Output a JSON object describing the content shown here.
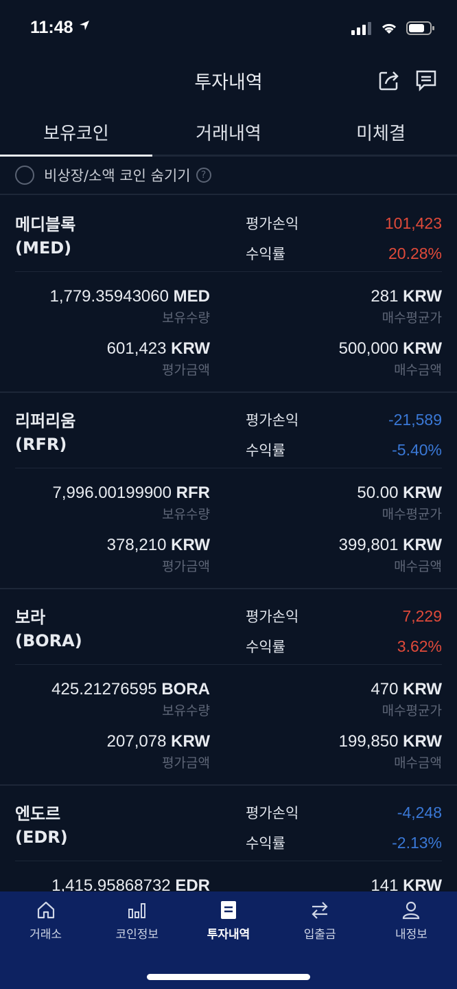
{
  "status": {
    "time": "11:48"
  },
  "header": {
    "title": "투자내역"
  },
  "tabs": [
    {
      "label": "보유코인",
      "active": true
    },
    {
      "label": "거래내역",
      "active": false
    },
    {
      "label": "미체결",
      "active": false
    }
  ],
  "filter": {
    "label": "비상장/소액 코인 숨기기",
    "help": "?"
  },
  "labels": {
    "pl": "평가손익",
    "rate": "수익률",
    "holding": "보유수량",
    "avg_price": "매수평균가",
    "eval_amount": "평가금액",
    "buy_amount": "매수금액"
  },
  "coins": [
    {
      "name": "메디블록",
      "symbol": "(MED)",
      "pl": "101,423",
      "rate": "20.28%",
      "trend": "up",
      "holding_num": "1,779.35943060",
      "holding_unit": "MED",
      "avg_num": "281",
      "avg_unit": "KRW",
      "eval_num": "601,423",
      "eval_unit": "KRW",
      "buy_num": "500,000",
      "buy_unit": "KRW"
    },
    {
      "name": "리퍼리움",
      "symbol": "(RFR)",
      "pl": "-21,589",
      "rate": "-5.40%",
      "trend": "down",
      "holding_num": "7,996.00199900",
      "holding_unit": "RFR",
      "avg_num": "50.00",
      "avg_unit": "KRW",
      "eval_num": "378,210",
      "eval_unit": "KRW",
      "buy_num": "399,801",
      "buy_unit": "KRW"
    },
    {
      "name": "보라",
      "symbol": "(BORA)",
      "pl": "7,229",
      "rate": "3.62%",
      "trend": "up",
      "holding_num": "425.21276595",
      "holding_unit": "BORA",
      "avg_num": "470",
      "avg_unit": "KRW",
      "eval_num": "207,078",
      "eval_unit": "KRW",
      "buy_num": "199,850",
      "buy_unit": "KRW"
    },
    {
      "name": "엔도르",
      "symbol": "(EDR)",
      "pl": "-4,248",
      "rate": "-2.13%",
      "trend": "down",
      "holding_num": "1,415.95868732",
      "holding_unit": "EDR",
      "avg_num": "141",
      "avg_unit": "KRW"
    }
  ],
  "nav": [
    {
      "label": "거래소",
      "icon": "home-icon",
      "active": false
    },
    {
      "label": "코인정보",
      "icon": "bar-chart-icon",
      "active": false
    },
    {
      "label": "투자내역",
      "icon": "document-icon",
      "active": true
    },
    {
      "label": "입출금",
      "icon": "transfer-icon",
      "active": false
    },
    {
      "label": "내정보",
      "icon": "user-icon",
      "active": false
    }
  ],
  "colors": {
    "up": "#e04a3a",
    "down": "#3a78d6",
    "nav_bg": "#0d2261",
    "bg": "#0b1424"
  }
}
